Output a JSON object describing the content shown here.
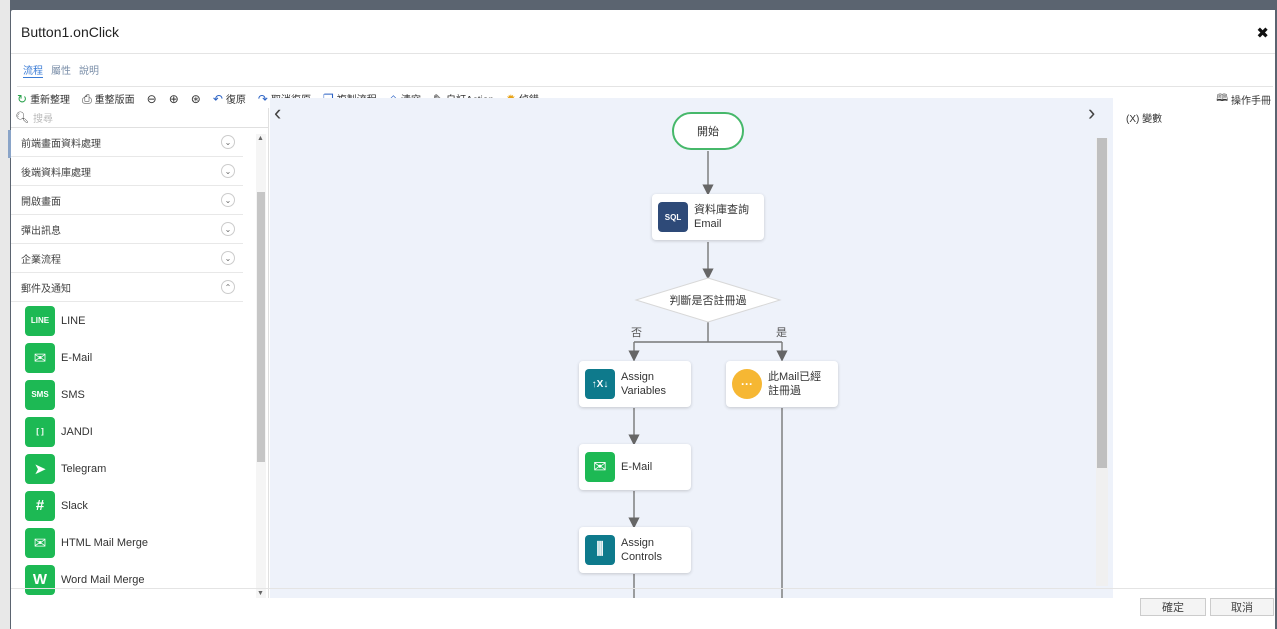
{
  "window": {
    "title": "Button1.onClick"
  },
  "tabs": [
    {
      "label": "流程",
      "active": true
    },
    {
      "label": "屬性",
      "active": false
    },
    {
      "label": "說明",
      "active": false
    }
  ],
  "toolbar": {
    "rearrange": "重新整理",
    "arrange_view": "重整版面",
    "undo": "復原",
    "redo": "取消復原",
    "copy_flow": "複製流程",
    "clear": "清空",
    "custom_action": "自訂Action",
    "debug": "偵錯",
    "manual": "操作手冊"
  },
  "sidebar": {
    "search_placeholder": "搜尋",
    "categories": [
      {
        "label": "前端畫面資料處理",
        "expanded": false
      },
      {
        "label": "後端資料庫處理",
        "expanded": false
      },
      {
        "label": "開啟畫面",
        "expanded": false
      },
      {
        "label": "彈出訊息",
        "expanded": false
      },
      {
        "label": "企業流程",
        "expanded": false
      },
      {
        "label": "郵件及通知",
        "expanded": true
      }
    ],
    "tools": [
      {
        "label": "LINE",
        "icon": "line-icon",
        "glyph": "LINE"
      },
      {
        "label": "E-Mail",
        "icon": "mail-icon",
        "glyph": "✉"
      },
      {
        "label": "SMS",
        "icon": "sms-icon",
        "glyph": "SMS"
      },
      {
        "label": "JANDI",
        "icon": "jandi-icon",
        "glyph": "[ ]"
      },
      {
        "label": "Telegram",
        "icon": "telegram-icon",
        "glyph": "➤"
      },
      {
        "label": "Slack",
        "icon": "slack-icon",
        "glyph": "#"
      },
      {
        "label": "HTML Mail Merge",
        "icon": "html-mail-merge-icon",
        "glyph": "✉"
      },
      {
        "label": "Word Mail Merge",
        "icon": "word-mail-merge-icon",
        "glyph": "W"
      }
    ]
  },
  "flow": {
    "start": "開始",
    "db_query": {
      "title": "資料庫查詢",
      "subtitle": "Email",
      "icon_text": "SQL"
    },
    "decision": "判斷是否註冊過",
    "branch_no": "否",
    "branch_yes": "是",
    "assign_vars": {
      "line1": "Assign",
      "line2": "Variables",
      "icon_text": "↑X↓"
    },
    "email": {
      "label": "E-Mail",
      "icon_text": "✉"
    },
    "assign_controls": {
      "line1": "Assign",
      "line2": "Controls",
      "icon_text": "⫼"
    },
    "registered_msg": {
      "line1": "此Mail已經",
      "line2": "註冊過",
      "icon_text": "···"
    }
  },
  "right_panel": {
    "label": "(X) 變數"
  },
  "footer": {
    "ok": "確定",
    "cancel": "取消"
  },
  "colors": {
    "green": "#1db954",
    "db_blue": "#2e4a78",
    "teal": "#0e7a8c",
    "orange": "#f6b733"
  }
}
